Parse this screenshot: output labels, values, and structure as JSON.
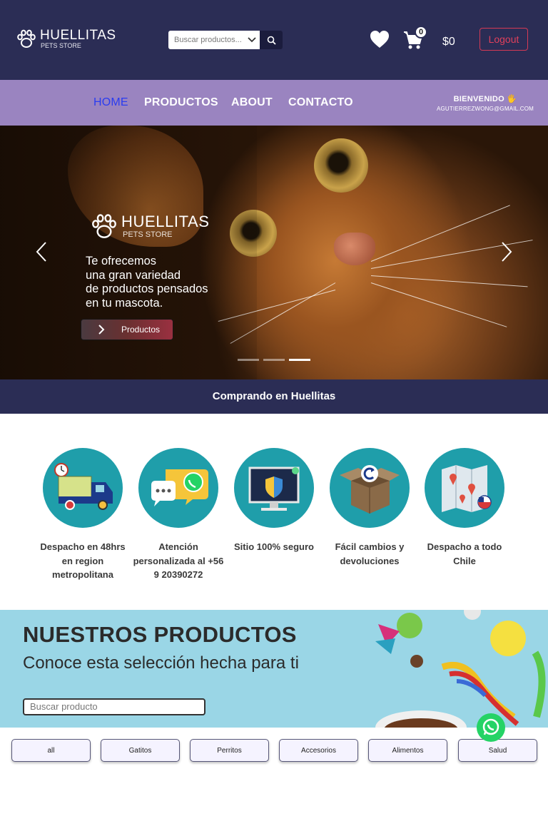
{
  "header": {
    "brand": "HUELLITAS",
    "brand_sub": "PETS STORE",
    "search_placeholder": "Buscar productos...",
    "cart_count": "0",
    "cart_total": "$0",
    "logout_label": "Logout"
  },
  "nav": {
    "items": [
      "HOME",
      "PRODUCTOS",
      "ABOUT",
      "CONTACTO"
    ],
    "active": "HOME",
    "welcome": "BIENVENIDO 🖐",
    "user_email": "AGUTIERREZWONG@GMAIL.COM"
  },
  "hero": {
    "brand": "HUELLITAS",
    "brand_sub": "PETS STORE",
    "lines": [
      "Te ofrecemos",
      "una gran variedad",
      "de productos pensados",
      "en tu mascota."
    ],
    "button_label": "Productos",
    "slide_count": 3,
    "active_slide": 3
  },
  "strip": {
    "text": "Comprando en Huellitas"
  },
  "features": [
    {
      "icon": "delivery-truck-icon",
      "label": "Despacho en 48hrs en region metropolitana"
    },
    {
      "icon": "whatsapp-chat-icon",
      "label": "Atención personalizada al +56 9 20390272"
    },
    {
      "icon": "secure-monitor-icon",
      "label": "Sitio 100% seguro"
    },
    {
      "icon": "return-box-icon",
      "label": "Fácil cambios y devoluciones"
    },
    {
      "icon": "chile-map-icon",
      "label": "Despacho a todo Chile"
    }
  ],
  "products": {
    "title": "NUESTROS PRODUCTOS",
    "subtitle": "Conoce esta selección hecha para ti",
    "search_placeholder": "Buscar producto"
  },
  "categories": [
    "all",
    "Gatitos",
    "Perritos",
    "Accesorios",
    "Alimentos",
    "Salud"
  ],
  "colors": {
    "header_bg": "#2b2d55",
    "nav_bg": "#9a84c0",
    "active_nav": "#2a3cf0",
    "feature_circle": "#1f9eaa",
    "logout": "#d63a55",
    "banner_bg": "#9ad6e6"
  }
}
